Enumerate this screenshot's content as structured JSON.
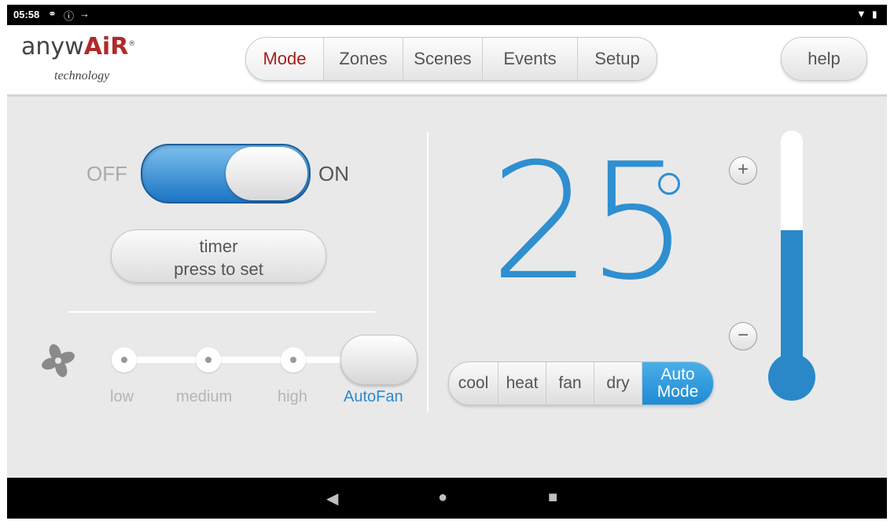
{
  "status_bar": {
    "time": "05:58",
    "icons": [
      "usb-icon",
      "info-icon",
      "charging-icon",
      "wifi-icon",
      "battery-icon"
    ]
  },
  "header": {
    "logo_brand_pre": "anyw",
    "logo_brand_accent": "AiR",
    "logo_reg": "®",
    "logo_sub": "technology",
    "tabs": [
      {
        "label": "Mode",
        "active": true
      },
      {
        "label": "Zones",
        "active": false
      },
      {
        "label": "Scenes",
        "active": false
      },
      {
        "label": "Events",
        "active": false
      },
      {
        "label": "Setup",
        "active": false
      }
    ],
    "help_label": "help"
  },
  "power": {
    "off_label": "OFF",
    "on_label": "ON",
    "state": "on"
  },
  "timer": {
    "line1": "timer",
    "line2": "press to set"
  },
  "fan": {
    "options": [
      "low",
      "medium",
      "high",
      "AutoFan"
    ],
    "selected": "AutoFan"
  },
  "thermostat": {
    "temperature": "25",
    "degree_symbol": "°",
    "fill_fraction": 0.6,
    "plus_label": "+",
    "minus_label": "−"
  },
  "modes": {
    "options": [
      "cool",
      "heat",
      "fan",
      "dry"
    ],
    "active_line1": "Auto",
    "active_line2": "Mode"
  },
  "nav_bar": {
    "back_icon": "back-triangle-icon",
    "home_icon": "home-circle-icon",
    "recents_icon": "recents-square-icon"
  },
  "colors": {
    "accent_blue": "#2f8fd0",
    "active_tab_red": "#a32020"
  }
}
